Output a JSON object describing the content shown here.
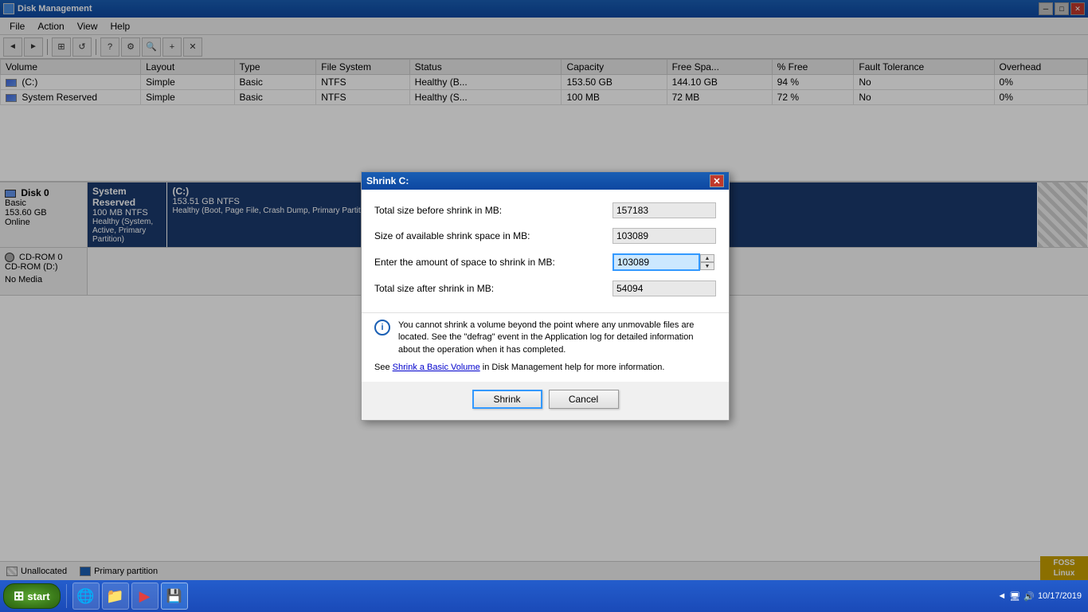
{
  "titleBar": {
    "title": "Disk Management",
    "closeBtn": "✕",
    "minBtn": "─",
    "maxBtn": "□"
  },
  "menuBar": {
    "items": [
      "File",
      "Action",
      "View",
      "Help"
    ]
  },
  "toolbar": {
    "buttons": [
      "◄",
      "►",
      "⊞",
      "⊟",
      "📋",
      "✎",
      "🔍",
      "⊕",
      "⊛"
    ]
  },
  "diskTable": {
    "columns": [
      "Volume",
      "Layout",
      "Type",
      "File System",
      "Status",
      "Capacity",
      "Free Spa...",
      "% Free",
      "Fault Tolerance",
      "Overhead"
    ],
    "rows": [
      {
        "volume": "(C:)",
        "layout": "Simple",
        "type": "Basic",
        "fileSystem": "NTFS",
        "status": "Healthy (B...",
        "capacity": "153.50 GB",
        "freeSpace": "144.10 GB",
        "percentFree": "94 %",
        "faultTolerance": "No",
        "overhead": "0%"
      },
      {
        "volume": "System Reserved",
        "layout": "Simple",
        "type": "Basic",
        "fileSystem": "NTFS",
        "status": "Healthy (S...",
        "capacity": "100 MB",
        "freeSpace": "72 MB",
        "percentFree": "72 %",
        "faultTolerance": "No",
        "overhead": "0%"
      }
    ]
  },
  "diskView": {
    "disks": [
      {
        "name": "Disk 0",
        "type": "Basic",
        "size": "153.60 GB",
        "status": "Online",
        "partitions": [
          {
            "name": "System Reserved",
            "size": "100 MB NTFS",
            "status": "Healthy (System, Active, Primary Partition)",
            "type": "primary"
          },
          {
            "name": "(C:)",
            "size": "153.51 GB NTFS",
            "status": "Healthy (Boot, Page File, Crash Dump, Primary Partition)",
            "type": "primary"
          },
          {
            "name": "",
            "size": "",
            "status": "",
            "type": "unallocated"
          }
        ]
      }
    ],
    "cdrom": {
      "name": "CD-ROM 0",
      "type": "CD-ROM (D:)",
      "status": "No Media"
    }
  },
  "legend": {
    "items": [
      {
        "label": "Unallocated",
        "type": "unallocated"
      },
      {
        "label": "Primary partition",
        "type": "primary"
      }
    ]
  },
  "dialog": {
    "title": "Shrink C:",
    "fields": {
      "totalSizeLabel": "Total size before shrink in MB:",
      "totalSizeValue": "157183",
      "availableShrinkLabel": "Size of available shrink space in MB:",
      "availableShrinkValue": "103089",
      "enterAmountLabel": "Enter the amount of space to shrink in MB:",
      "enterAmountValue": "103089",
      "totalAfterLabel": "Total size after shrink in MB:",
      "totalAfterValue": "54094"
    },
    "infoText": "You cannot shrink a volume beyond the point where any unmovable files are located. See the \"defrag\" event in the Application log for detailed information about the operation when it has completed.",
    "helpText": "See ",
    "helpLink": "Shrink a Basic Volume",
    "helpTextAfter": " in Disk Management help for more information.",
    "buttons": {
      "shrink": "Shrink",
      "cancel": "Cancel"
    }
  },
  "taskbar": {
    "startLabel": "start",
    "time": "10/17/2019",
    "appButtons": [
      "IE",
      "Explorer",
      "Media",
      "Tools"
    ]
  },
  "fossBadge": {
    "line1": "FOSS",
    "line2": "Linux"
  }
}
